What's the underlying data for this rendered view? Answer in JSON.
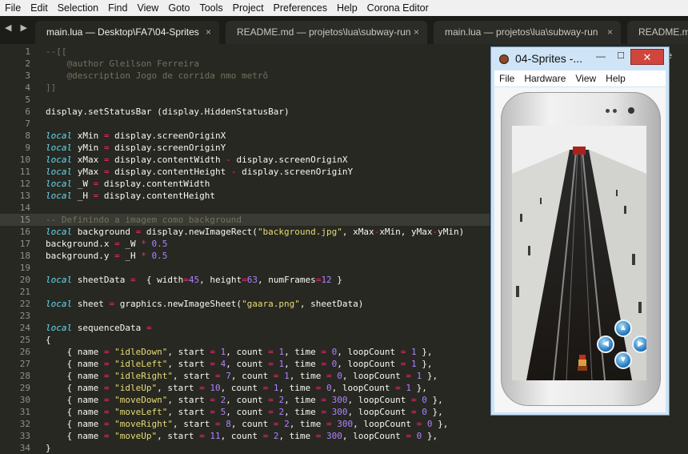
{
  "menu": [
    "File",
    "Edit",
    "Selection",
    "Find",
    "View",
    "Goto",
    "Tools",
    "Project",
    "Preferences",
    "Help",
    "Corona Editor"
  ],
  "tabs": [
    {
      "label": "main.lua — Desktop\\FA7\\04-Sprites",
      "active": true
    },
    {
      "label": "README.md — projetos\\lua\\subway-run",
      "active": false
    },
    {
      "label": "main.lua — projetos\\lua\\subway-run",
      "active": false
    },
    {
      "label": "README.md — proje",
      "active": false
    }
  ],
  "tab_close_glyph": "×",
  "nav_arrows": "◀ ▶",
  "code_lines": [
    {
      "n": "1",
      "t": "--[["
    },
    {
      "n": "2",
      "t": "    @author Gleilson Ferreira"
    },
    {
      "n": "3",
      "t": "    @description Jogo de corrida nmo metrô"
    },
    {
      "n": "4",
      "t": "]]"
    },
    {
      "n": "5",
      "t": ""
    },
    {
      "n": "6",
      "t": "display.setStatusBar (display.HiddenStatusBar)"
    },
    {
      "n": "7",
      "t": ""
    },
    {
      "n": "8",
      "t": "local xMin = display.screenOriginX"
    },
    {
      "n": "9",
      "t": "local yMin = display.screenOriginY"
    },
    {
      "n": "10",
      "t": "local xMax = display.contentWidth - display.screenOriginX"
    },
    {
      "n": "11",
      "t": "local yMax = display.contentHeight - display.screenOriginY"
    },
    {
      "n": "12",
      "t": "local _W = display.contentWidth"
    },
    {
      "n": "13",
      "t": "local _H = display.contentHeight"
    },
    {
      "n": "14",
      "t": ""
    },
    {
      "n": "15",
      "t": "-- Definindo a imagem como background"
    },
    {
      "n": "16",
      "t": "local background = display.newImageRect(\"background.jpg\", xMax-xMin, yMax-yMin)"
    },
    {
      "n": "17",
      "t": "background.x = _W * 0.5"
    },
    {
      "n": "18",
      "t": "background.y = _H * 0.5"
    },
    {
      "n": "19",
      "t": ""
    },
    {
      "n": "20",
      "t": "local sheetData =  { width=45, height=63, numFrames=12 }"
    },
    {
      "n": "21",
      "t": ""
    },
    {
      "n": "22",
      "t": "local sheet = graphics.newImageSheet(\"gaara.png\", sheetData)"
    },
    {
      "n": "23",
      "t": ""
    },
    {
      "n": "24",
      "t": "local sequenceData ="
    },
    {
      "n": "25",
      "t": "{"
    },
    {
      "n": "26",
      "t": "    { name = \"idleDown\", start = 1, count = 1, time = 0, loopCount = 1 },"
    },
    {
      "n": "27",
      "t": "    { name = \"idleLeft\", start = 4, count = 1, time = 0, loopCount = 1 },"
    },
    {
      "n": "28",
      "t": "    { name = \"idleRight\", start = 7, count = 1, time = 0, loopCount = 1 },"
    },
    {
      "n": "29",
      "t": "    { name = \"idleUp\", start = 10, count = 1, time = 0, loopCount = 1 },"
    },
    {
      "n": "30",
      "t": "    { name = \"moveDown\", start = 2, count = 2, time = 300, loopCount = 0 },"
    },
    {
      "n": "31",
      "t": "    { name = \"moveLeft\", start = 5, count = 2, time = 300, loopCount = 0 },"
    },
    {
      "n": "32",
      "t": "    { name = \"moveRight\", start = 8, count = 2, time = 300, loopCount = 0 },"
    },
    {
      "n": "33",
      "t": "    { name = \"moveUp\", start = 11, count = 2, time = 300, loopCount = 0 },"
    },
    {
      "n": "34",
      "t": "}"
    }
  ],
  "highlighted_line": "15",
  "simulator": {
    "title": "04-Sprites -...",
    "min_glyph": "—",
    "max_glyph": "☐",
    "close_glyph": "✕",
    "menu": [
      "File",
      "Hardware",
      "View",
      "Help"
    ],
    "dpad": {
      "up": "▲",
      "down": "▼",
      "left": "◀",
      "right": "▶"
    }
  },
  "colors": {
    "editor_bg": "#272822",
    "comment": "#75715e",
    "keyword": "#66d9ef",
    "string": "#e6db74",
    "number": "#ae81ff",
    "operator": "#f92672"
  }
}
